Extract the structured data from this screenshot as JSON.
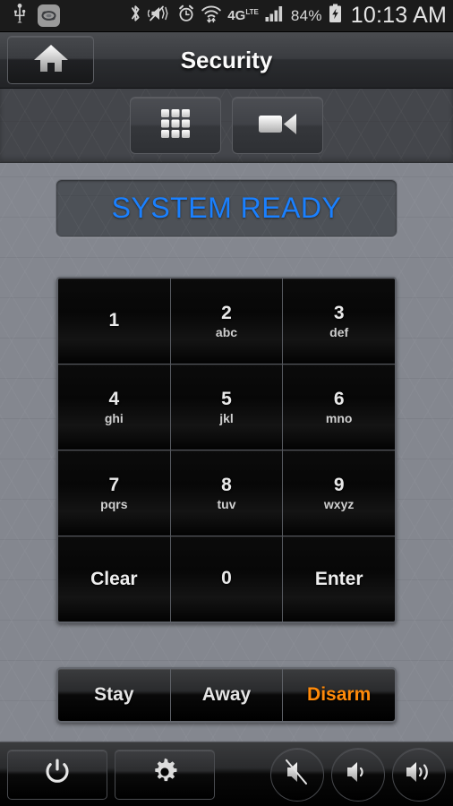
{
  "statusbar": {
    "left_icons": [
      {
        "name": "usb-icon",
        "label": "USB"
      },
      {
        "name": "screen-rotation-icon",
        "label": "Screen rotation"
      }
    ],
    "right_icons": [
      {
        "name": "bluetooth-icon",
        "label": "Bluetooth"
      },
      {
        "name": "vibrate-mute-icon",
        "label": "Silent / vibrate"
      },
      {
        "name": "alarm-clock-icon",
        "label": "Alarm set"
      },
      {
        "name": "wifi-icon",
        "label": "Wi-Fi"
      },
      {
        "name": "4g-lte-icon",
        "label": "4G LTE"
      },
      {
        "name": "cell-signal-icon",
        "label": "Cellular signal"
      }
    ],
    "network_label": "4G",
    "network_sub": "LTE",
    "battery_percent": "84%",
    "battery_icon": "battery-charging-icon",
    "clock": "10:13 AM"
  },
  "titlebar": {
    "home_icon": "home-icon",
    "home_label": "Home",
    "title": "Security"
  },
  "tabs": [
    {
      "name": "tab-keypad",
      "icon": "keypad-grid-icon",
      "label": "Keypad",
      "selected": true
    },
    {
      "name": "tab-cameras",
      "icon": "video-camera-icon",
      "label": "Cameras",
      "selected": false
    }
  ],
  "status_panel": {
    "text": "SYSTEM READY",
    "color": "#1a80ff"
  },
  "keypad": [
    {
      "digit": "1",
      "letters": ""
    },
    {
      "digit": "2",
      "letters": "abc"
    },
    {
      "digit": "3",
      "letters": "def"
    },
    {
      "digit": "4",
      "letters": "ghi"
    },
    {
      "digit": "5",
      "letters": "jkl"
    },
    {
      "digit": "6",
      "letters": "mno"
    },
    {
      "digit": "7",
      "letters": "pqrs"
    },
    {
      "digit": "8",
      "letters": "tuv"
    },
    {
      "digit": "9",
      "letters": "wxyz"
    },
    {
      "digit": "Clear",
      "letters": ""
    },
    {
      "digit": "0",
      "letters": ""
    },
    {
      "digit": "Enter",
      "letters": ""
    }
  ],
  "modes": [
    {
      "label": "Stay",
      "accent": false
    },
    {
      "label": "Away",
      "accent": false
    },
    {
      "label": "Disarm",
      "accent": true
    }
  ],
  "accent_color": "#ff8a0a",
  "bottombar": [
    {
      "name": "power-button",
      "icon": "power-icon",
      "label": "Power",
      "shape": "rect"
    },
    {
      "name": "settings-button",
      "icon": "gear-icon",
      "label": "Settings",
      "shape": "rect"
    },
    {
      "name": "mute-button",
      "icon": "volume-mute-icon",
      "label": "Mute",
      "shape": "circle"
    },
    {
      "name": "volume-down-button",
      "icon": "volume-low-icon",
      "label": "Volume down",
      "shape": "circle"
    },
    {
      "name": "volume-up-button",
      "icon": "volume-high-icon",
      "label": "Volume up",
      "shape": "circle"
    }
  ]
}
